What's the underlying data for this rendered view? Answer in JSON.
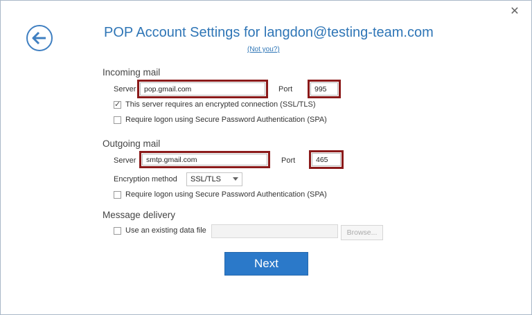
{
  "dialog": {
    "title": "POP Account Settings for langdon@testing-team.com",
    "not_you": "(Not you?)",
    "close_glyph": "✕"
  },
  "incoming": {
    "heading": "Incoming mail",
    "server_label": "Server",
    "server_value": "pop.gmail.com",
    "port_label": "Port",
    "port_value": "995",
    "ssl_label": "This server requires an encrypted connection (SSL/TLS)",
    "ssl_checked": true,
    "spa_label": "Require logon using Secure Password Authentication (SPA)",
    "spa_checked": false
  },
  "outgoing": {
    "heading": "Outgoing mail",
    "server_label": "Server",
    "server_value": "smtp.gmail.com",
    "port_label": "Port",
    "port_value": "465",
    "encryption_label": "Encryption method",
    "encryption_value": "SSL/TLS",
    "spa_label": "Require logon using Secure Password Authentication (SPA)",
    "spa_checked": false
  },
  "delivery": {
    "heading": "Message delivery",
    "existing_label": "Use an existing data file",
    "existing_checked": false,
    "browse_label": "Browse..."
  },
  "actions": {
    "next_label": "Next"
  },
  "colors": {
    "accent": "#2e75b6",
    "highlight": "#8b1a1a",
    "button": "#2b79c9"
  },
  "icons": {
    "back": "back-arrow-icon",
    "close": "close-icon",
    "dropdown": "chevron-down-icon"
  }
}
